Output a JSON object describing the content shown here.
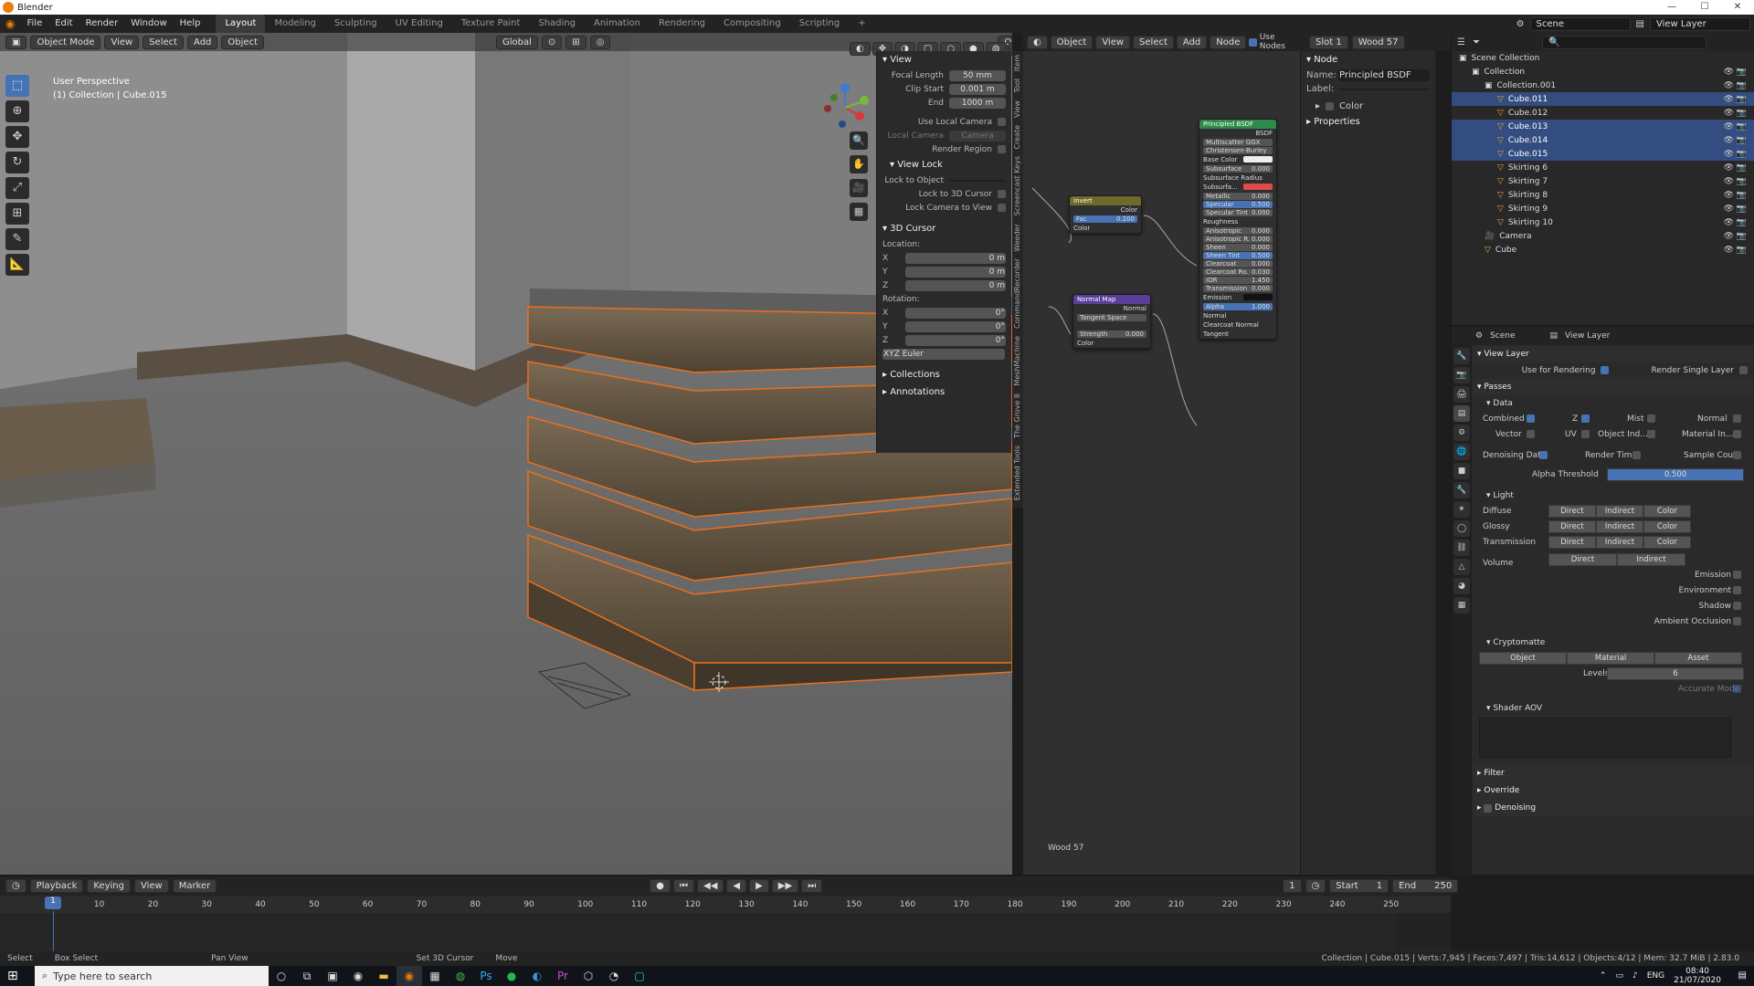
{
  "window": {
    "title": "Blender",
    "controls": [
      "—",
      "☐",
      "✕"
    ]
  },
  "topbar": {
    "menus": [
      "File",
      "Edit",
      "Render",
      "Window",
      "Help"
    ],
    "workspaces": [
      "Layout",
      "Modeling",
      "Sculpting",
      "UV Editing",
      "Texture Paint",
      "Shading",
      "Animation",
      "Rendering",
      "Compositing",
      "Scripting",
      "+"
    ],
    "active_workspace": "Layout",
    "scene": "Scene",
    "view_layer": "View Layer"
  },
  "viewport": {
    "mode": "Object Mode",
    "menus": [
      "View",
      "Select",
      "Add",
      "Object"
    ],
    "transform": "Global",
    "options": "Options",
    "perspective": "User Perspective",
    "collection_info": "(1) Collection | Cube.015"
  },
  "npanel": {
    "tabs": [
      "Item",
      "Tool",
      "View",
      "Create",
      "Screencast Keys",
      "Weeder",
      "CommandRecorder",
      "MeshMachine",
      "The Grove 8",
      "Extended Tools"
    ],
    "view_title": "View",
    "focal_label": "Focal Length",
    "focal_val": "50 mm",
    "clip_start_label": "Clip Start",
    "clip_start_val": "0.001 m",
    "end_label": "End",
    "end_val": "1000 m",
    "use_local_camera": "Use Local Camera",
    "local_camera_label": "Local Camera",
    "local_camera_val": "Camera",
    "render_region": "Render Region",
    "view_lock": "View Lock",
    "lock_object": "Lock to Object",
    "lock_cursor": "Lock to 3D Cursor",
    "lock_camera": "Lock Camera to View",
    "cursor_title": "3D Cursor",
    "location": "Location:",
    "loc_x": "0 m",
    "loc_y": "0 m",
    "loc_z": "0 m",
    "rotation": "Rotation:",
    "rot_x": "0°",
    "rot_y": "0°",
    "rot_z": "0°",
    "rotation_mode": "XYZ Euler",
    "collections": "Collections",
    "annotations": "Annotations"
  },
  "node_editor": {
    "object": "Object",
    "menus": [
      "View",
      "Select",
      "Add",
      "Node"
    ],
    "use_nodes": "Use Nodes",
    "slot": "Slot 1",
    "material": "Wood 57",
    "footer_material": "Wood 57",
    "panel_title": "Node",
    "name_label": "Name:",
    "name_val": "Principled BSDF",
    "label_label": "Label:",
    "color_label": "Color",
    "properties_label": "Properties",
    "invert": {
      "title": "Invert",
      "rows": [
        "Color",
        "Fac",
        "Color"
      ],
      "fac": "0.200"
    },
    "normal_map": {
      "title": "Normal Map",
      "out": "Normal",
      "space": "Tangent Space",
      "strength_label": "Strength",
      "strength": "0.000",
      "in": "Color"
    },
    "bsdf": {
      "title": "Principled BSDF",
      "out": "BSDF",
      "dist": "Multiscatter GGX",
      "sss": "Christensen-Burley",
      "rows": [
        {
          "l": "Base Color",
          "v": ""
        },
        {
          "l": "Subsurface",
          "v": "0.000"
        },
        {
          "l": "Subsurface Radius",
          "v": ""
        },
        {
          "l": "Subsurfa...",
          "v": ""
        },
        {
          "l": "Metallic",
          "v": "0.000"
        },
        {
          "l": "Specular",
          "v": "0.500"
        },
        {
          "l": "Specular Tint",
          "v": "0.000"
        },
        {
          "l": "Roughness",
          "v": ""
        },
        {
          "l": "Anisotropic",
          "v": "0.000"
        },
        {
          "l": "Anisotropic R.",
          "v": "0.000"
        },
        {
          "l": "Sheen",
          "v": "0.000"
        },
        {
          "l": "Sheen Tint",
          "v": "0.500"
        },
        {
          "l": "Clearcoat",
          "v": "0.000"
        },
        {
          "l": "Clearcoat Ro.",
          "v": "0.030"
        },
        {
          "l": "IOR",
          "v": "1.450"
        },
        {
          "l": "Transmission",
          "v": "0.000"
        },
        {
          "l": "Emission",
          "v": ""
        },
        {
          "l": "Alpha",
          "v": "1.000"
        },
        {
          "l": "Normal",
          "v": ""
        },
        {
          "l": "Clearcoat Normal",
          "v": ""
        },
        {
          "l": "Tangent",
          "v": ""
        }
      ]
    }
  },
  "outliner": {
    "rows": [
      {
        "name": "Scene Collection",
        "indent": 0,
        "sel": false
      },
      {
        "name": "Collection",
        "indent": 1,
        "sel": false
      },
      {
        "name": "Collection.001",
        "indent": 2,
        "sel": false
      },
      {
        "name": "Cube.011",
        "indent": 3,
        "sel": true
      },
      {
        "name": "Cube.012",
        "indent": 3,
        "sel": false
      },
      {
        "name": "Cube.013",
        "indent": 3,
        "sel": true
      },
      {
        "name": "Cube.014",
        "indent": 3,
        "sel": true
      },
      {
        "name": "Cube.015",
        "indent": 3,
        "sel": true
      },
      {
        "name": "Skirting 6",
        "indent": 3,
        "sel": false
      },
      {
        "name": "Skirting 7",
        "indent": 3,
        "sel": false
      },
      {
        "name": "Skirting 8",
        "indent": 3,
        "sel": false
      },
      {
        "name": "Skirting 9",
        "indent": 3,
        "sel": false
      },
      {
        "name": "Skirting 10",
        "indent": 3,
        "sel": false
      },
      {
        "name": "Camera",
        "indent": 2,
        "sel": false
      },
      {
        "name": "Cube",
        "indent": 2,
        "sel": false
      }
    ]
  },
  "properties": {
    "scene": "Scene",
    "view_layer": "View Layer",
    "view_layer_title": "View Layer",
    "use_for_rendering": "Use for Rendering",
    "render_single_layer": "Render Single Layer",
    "passes": "Passes",
    "data": "Data",
    "combined": "Combined",
    "z": "Z",
    "mist": "Mist",
    "normal": "Normal",
    "vector": "Vector",
    "uv": "UV",
    "object_index": "Object Ind...",
    "material_index": "Material In...",
    "denoising_data": "Denoising Data",
    "render_time": "Render Time",
    "sample_count": "Sample Count",
    "alpha_threshold": "Alpha Threshold",
    "alpha_threshold_val": "0.500",
    "light": "Light",
    "diffuse": "Diffuse",
    "glossy": "Glossy",
    "transmission": "Transmission",
    "volume": "Volume",
    "direct": "Direct",
    "indirect": "Indirect",
    "color": "Color",
    "emission": "Emission",
    "environment": "Environment",
    "shadow": "Shadow",
    "ambient_occlusion": "Ambient Occlusion",
    "cryptomatte": "Cryptomatte",
    "crypto_object": "Object",
    "crypto_material": "Material",
    "crypto_asset": "Asset",
    "levels": "Levels",
    "levels_val": "6",
    "accurate_mode": "Accurate Mode",
    "shader_aov": "Shader AOV",
    "filter": "Filter",
    "override": "Override",
    "denoising": "Denoising"
  },
  "timeline": {
    "menus": [
      "Playback",
      "Keying",
      "View",
      "Marker"
    ],
    "current_frame": "1",
    "start_label": "Start",
    "start": "1",
    "end_label": "End",
    "end": "250",
    "ticks": [
      "1",
      "10",
      "20",
      "30",
      "40",
      "50",
      "60",
      "70",
      "80",
      "90",
      "100",
      "110",
      "120",
      "130",
      "140",
      "150",
      "160",
      "170",
      "180",
      "190",
      "200",
      "210",
      "220",
      "230",
      "240",
      "250"
    ]
  },
  "statusbar": {
    "hints": [
      "Select",
      "Box Select",
      "Pan View",
      "Set 3D Cursor",
      "Move"
    ],
    "stats": "Collection | Cube.015 | Verts:7,945 | Faces:7,497 | Tris:14,612 | Objects:4/12 | Mem: 32.7 MiB | 2.83.0"
  },
  "taskbar": {
    "search_placeholder": "Type here to search",
    "lang": "ENG",
    "time": "08:40",
    "date": "21/07/2020"
  }
}
